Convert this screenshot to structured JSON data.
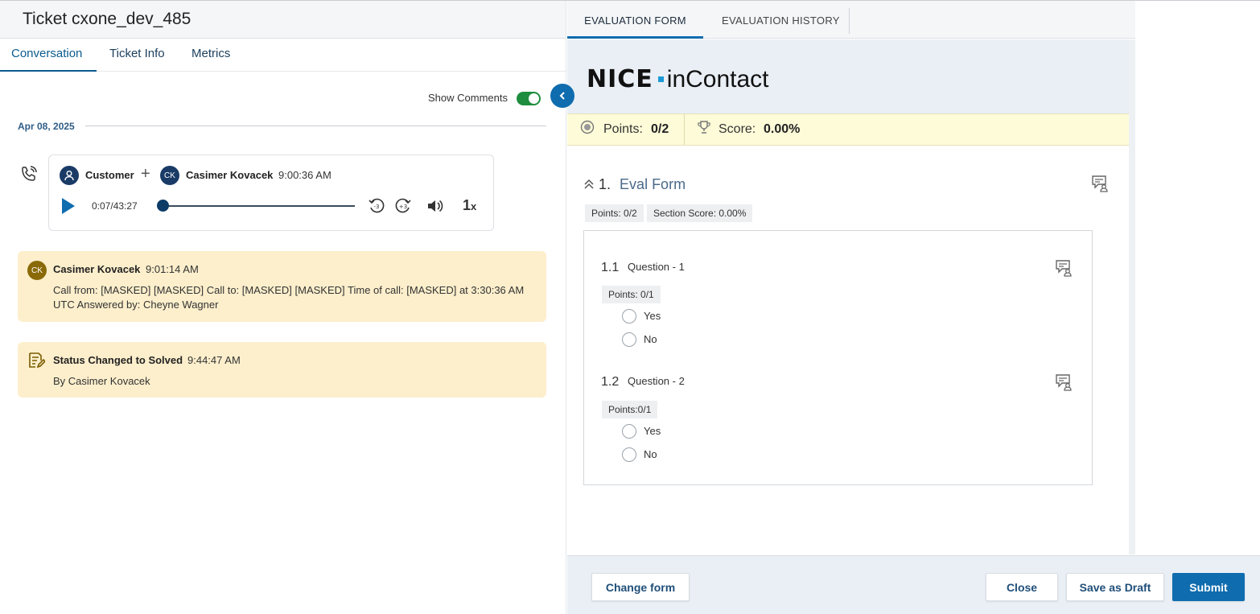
{
  "ticket": {
    "title": "Ticket cxone_dev_485"
  },
  "left_tabs": [
    {
      "label": "Conversation",
      "active": true
    },
    {
      "label": "Ticket Info",
      "active": false
    },
    {
      "label": "Metrics",
      "active": false
    }
  ],
  "show_comments": {
    "label": "Show Comments",
    "enabled": true
  },
  "date_label": "Apr 08, 2025",
  "audio": {
    "participant_1": "Customer",
    "participant_2_initials": "CK",
    "participant_2": "Casimer Kovacek",
    "time": "9:00:36 AM",
    "position": "0:07/43:27",
    "progress_fraction": 0.003,
    "speed": "1",
    "speed_suffix": "x",
    "rewind_label": "-3",
    "forward_label": "+3"
  },
  "messages": [
    {
      "initials": "CK",
      "name": "Casimer Kovacek",
      "time": "9:01:14 AM",
      "body": "Call from: [MASKED] [MASKED] Call to: [MASKED] [MASKED] Time of call: [MASKED] at 3:30:36 AM UTC Answered by: Cheyne Wagner"
    },
    {
      "name": "Status Changed to Solved",
      "time": "9:44:47 AM",
      "body": "By Casimer Kovacek"
    }
  ],
  "right_tabs": [
    {
      "label": "EVALUATION FORM",
      "active": true
    },
    {
      "label": "EVALUATION HISTORY",
      "active": false
    }
  ],
  "logo": {
    "left": "NICE",
    "right": "inContact"
  },
  "summary": {
    "points_label": "Points:",
    "points_value": "0/2",
    "score_label": "Score:",
    "score_value": "0.00%"
  },
  "section": {
    "number": "1.",
    "title": "Eval Form",
    "points_chip": "Points: 0/2",
    "score_chip": "Section Score: 0.00%",
    "questions": [
      {
        "number": "1.1",
        "title": "Question - 1",
        "points": "Points: 0/1",
        "options": [
          "Yes",
          "No"
        ]
      },
      {
        "number": "1.2",
        "title": "Question - 2",
        "points": "Points:0/1",
        "options": [
          "Yes",
          "No"
        ]
      }
    ]
  },
  "footer": {
    "change_form": "Change form",
    "close": "Close",
    "save_draft": "Save as Draft",
    "submit": "Submit"
  },
  "colors": {
    "accent": "#0f6cae",
    "message_bg": "#fdefcc",
    "score_band": "#fdfbd8",
    "toggle_on": "#1e8e3e"
  }
}
